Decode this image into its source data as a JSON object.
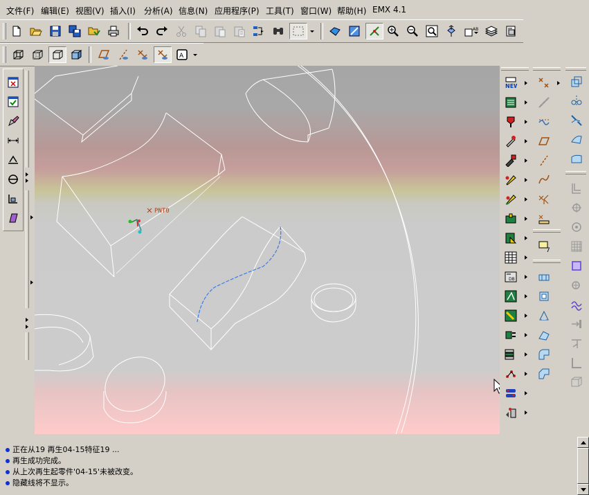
{
  "menubar": {
    "items": [
      {
        "label": "文件(F)"
      },
      {
        "label": "编辑(E)"
      },
      {
        "label": "视图(V)"
      },
      {
        "label": "插入(I)"
      },
      {
        "label": "分析(A)"
      },
      {
        "label": "信息(N)"
      },
      {
        "label": "应用程序(P)"
      },
      {
        "label": "工具(T)"
      },
      {
        "label": "窗口(W)"
      },
      {
        "label": "帮助(H)"
      },
      {
        "label": "EMX 4.1"
      }
    ]
  },
  "graphics": {
    "datum_point_label": "PNT0"
  },
  "messages": [
    {
      "text": "正在从19 再生04-15特征19 ..."
    },
    {
      "text": "再生成功完成。"
    },
    {
      "text": "从上次再生起零件'04-15'未被改变。"
    },
    {
      "text": "隐藏线将不显示。"
    }
  ],
  "icons": {
    "file_toolbar": [
      "new-file-icon",
      "open-file-icon",
      "save-icon",
      "save-copy-icon",
      "erase-icon",
      "print-icon"
    ],
    "edit_toolbar": [
      "undo-icon",
      "redo-icon",
      "cut-icon",
      "copy-icon",
      "paste-icon",
      "paste-special-icon",
      "regenerate-icon",
      "find-icon",
      "select-box-icon"
    ],
    "view_toolbar": [
      "repaint-icon",
      "orient-icon",
      "spin-center-icon",
      "zoom-in-icon",
      "zoom-out-icon",
      "refit-icon",
      "named-view-icon",
      "layer-icon",
      "layers-icon",
      "model-tree-icon"
    ],
    "display_toolbar": [
      "wireframe-icon",
      "hidden-line-icon",
      "no-hidden-icon",
      "shading-icon",
      "datum-planes-icon",
      "datum-axes-icon",
      "datum-points-icon",
      "datum-csys-icon",
      "spin-center-toggle-icon"
    ]
  },
  "colors": {
    "ui_background": "#d4d0c8",
    "model_edges": "#ffffff",
    "highlight_curve": "#3b7ce8",
    "datum_point": "#b0401a",
    "message_bullet": "#1030d0"
  }
}
